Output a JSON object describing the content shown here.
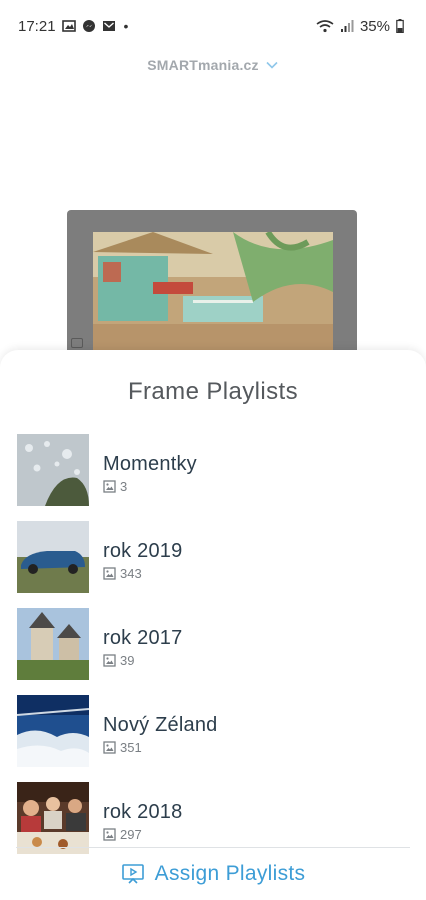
{
  "status_bar": {
    "time": "17:21",
    "battery": "35%",
    "notification_icons": [
      "gallery-icon",
      "messenger-icon",
      "gmail-icon"
    ],
    "system_icons": [
      "wifi-icon",
      "signal-icon",
      "battery-icon"
    ]
  },
  "header": {
    "device_name": "SMARTmania.cz",
    "dropdown_icon": "chevron-down-icon"
  },
  "sheet": {
    "title": "Frame Playlists",
    "playlists": [
      {
        "name": "Momentky",
        "count": "3"
      },
      {
        "name": "rok 2019",
        "count": "343"
      },
      {
        "name": "rok 2017",
        "count": "39"
      },
      {
        "name": "Nový Zéland",
        "count": "351"
      },
      {
        "name": "rok 2018",
        "count": "297"
      }
    ],
    "assign_label": "Assign Playlists"
  },
  "colors": {
    "accent": "#3d9dd6",
    "title": "#55595d",
    "item_text": "#2d3e4c",
    "muted": "#7a7f84"
  }
}
